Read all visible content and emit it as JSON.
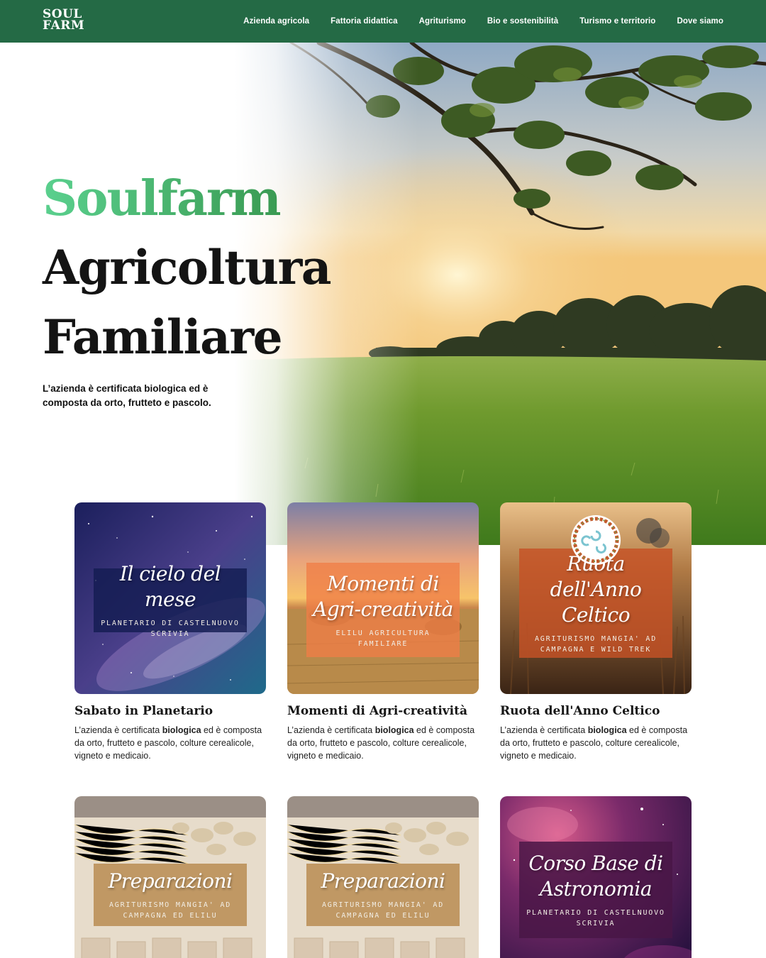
{
  "brand": {
    "logo_line1": "SOUL",
    "logo_line2": "FARM",
    "primary": "#246a45",
    "accent_green": "#4bbf78"
  },
  "nav": [
    {
      "label": "Azienda agricola"
    },
    {
      "label": "Fattoria didattica"
    },
    {
      "label": "Agriturismo"
    },
    {
      "label": "Bio e sostenibilità"
    },
    {
      "label": "Turismo e territorio"
    },
    {
      "label": "Dove siamo"
    }
  ],
  "hero": {
    "title_green": "Soulfarm",
    "title_line1": "Agricoltura",
    "title_line2": "Familiare",
    "description": "L’azienda è certificata biologica ed è composta da orto, frutteto e pascolo."
  },
  "cards": [
    {
      "overlay_title": "Il cielo del mese",
      "overlay_subtitle": "PLANETARIO DI CASTELNUOVO SCRIVIA",
      "title": "Sabato in Planetario",
      "text_pre": "L’azienda è certificata ",
      "text_bold": "biologica",
      "text_post": " ed è composta da orto, frutteto e pascolo, colture cerealicole, vigneto e medicaio.",
      "image": "milky-way-night-sky"
    },
    {
      "overlay_title": "Momenti di Agri-creatività",
      "overlay_subtitle": "ELILU AGRICULTURA FAMILIARE",
      "title": "Momenti di Agri-creatività",
      "text_pre": "L’azienda è certificata ",
      "text_bold": "biologica",
      "text_post": " ed è composta da orto, frutteto e pascolo, colture cerealicole, vigneto e medicaio.",
      "image": "sunset-hay-field"
    },
    {
      "overlay_title": "Ruota dell'Anno Celtico",
      "overlay_subtitle": "AGRITURISMO MANGIA' AD CAMPAGNA E WILD TREK",
      "title": "Ruota dell'Anno Celtico",
      "text_pre": "L’azienda è certificata ",
      "text_bold": "biologica",
      "text_post": " ed è composta da orto, frutteto e pascolo, colture cerealicole, vigneto e medicaio.",
      "image": "wheat-field-celtic-wreath"
    },
    {
      "overlay_title": "Preparazioni",
      "overlay_subtitle": "AGRITURISMO MANGIA' AD CAMPAGNA ED ELILU",
      "image": "fresh-pasta"
    },
    {
      "overlay_title": "Preparazioni",
      "overlay_subtitle": "AGRITURISMO MANGIA' AD CAMPAGNA ED ELILU",
      "image": "fresh-pasta"
    },
    {
      "overlay_title": "Corso Base di Astronomia",
      "overlay_subtitle": "PLANETARIO DI CASTELNUOVO SCRIVIA",
      "image": "nebula-space"
    }
  ]
}
